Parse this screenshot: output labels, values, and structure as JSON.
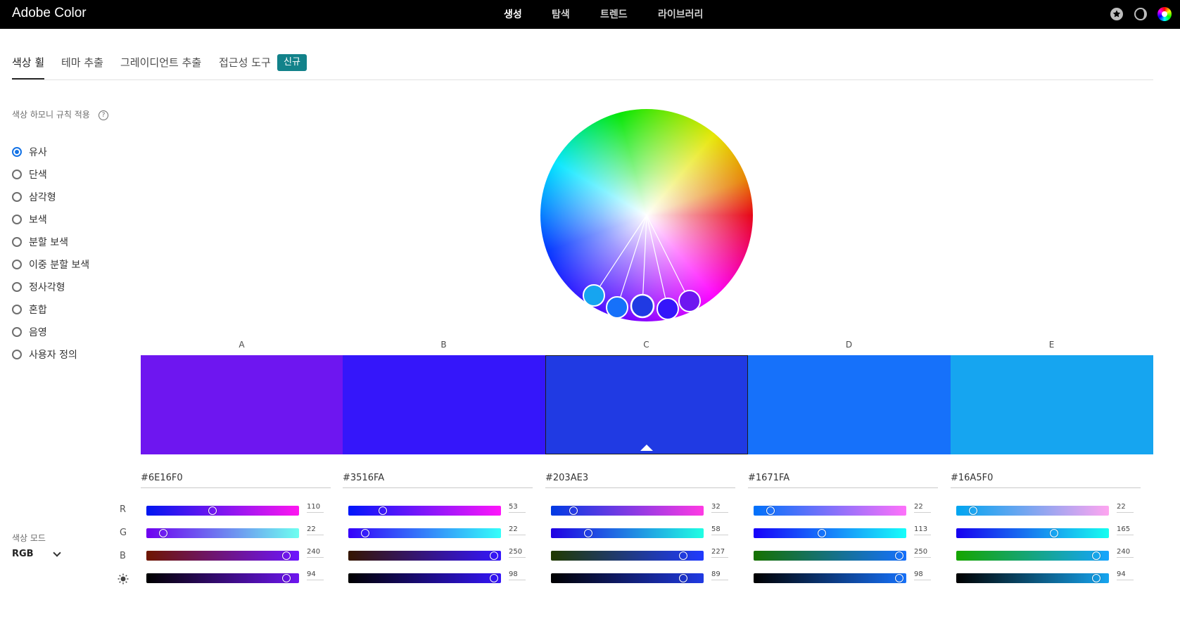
{
  "app": {
    "brand": "Adobe Color"
  },
  "nav": [
    {
      "label": "생성",
      "active": true
    },
    {
      "label": "탐색",
      "active": false
    },
    {
      "label": "트렌드",
      "active": false
    },
    {
      "label": "라이브러리",
      "active": false
    }
  ],
  "top_icons": [
    "star-icon",
    "moon-icon",
    "color-wheel-icon"
  ],
  "subtabs": [
    {
      "label": "색상 휠",
      "active": true
    },
    {
      "label": "테마 추출",
      "active": false
    },
    {
      "label": "그레이디언트 추출",
      "active": false
    },
    {
      "label": "접근성 도구",
      "active": false
    }
  ],
  "badge_new": "신규",
  "harmony": {
    "title": "색상 하모니 규칙 적용",
    "help_icon": "?",
    "rules": [
      "유사",
      "단색",
      "삼각형",
      "보색",
      "분할 보색",
      "이중 분할 보색",
      "정사각형",
      "혼합",
      "음영",
      "사용자 정의"
    ],
    "selected": 0
  },
  "color_mode": {
    "label": "색상 모드",
    "value": "RGB"
  },
  "channels": [
    "R",
    "G",
    "B",
    "brightness-icon"
  ],
  "swatches": [
    {
      "label": "A",
      "hex": "#6E16F0",
      "color": "#6e16f0",
      "r": 110,
      "g": 22,
      "b": 240,
      "v": 94
    },
    {
      "label": "B",
      "hex": "#3516FA",
      "color": "#3516fa",
      "r": 53,
      "g": 22,
      "b": 250,
      "v": 98
    },
    {
      "label": "C",
      "hex": "#203AE3",
      "color": "#203ae3",
      "r": 32,
      "g": 58,
      "b": 227,
      "v": 89
    },
    {
      "label": "D",
      "hex": "#1671FA",
      "color": "#1671fa",
      "r": 22,
      "g": 113,
      "b": 250,
      "v": 98
    },
    {
      "label": "E",
      "hex": "#16A5F0",
      "color": "#16a5f0",
      "r": 22,
      "g": 165,
      "b": 240,
      "v": 94
    }
  ],
  "active_swatch": 2,
  "wheel_handle_colors": [
    "#16a5f0",
    "#1671fa",
    "#203ae3",
    "#3516fa",
    "#6e16f0"
  ]
}
